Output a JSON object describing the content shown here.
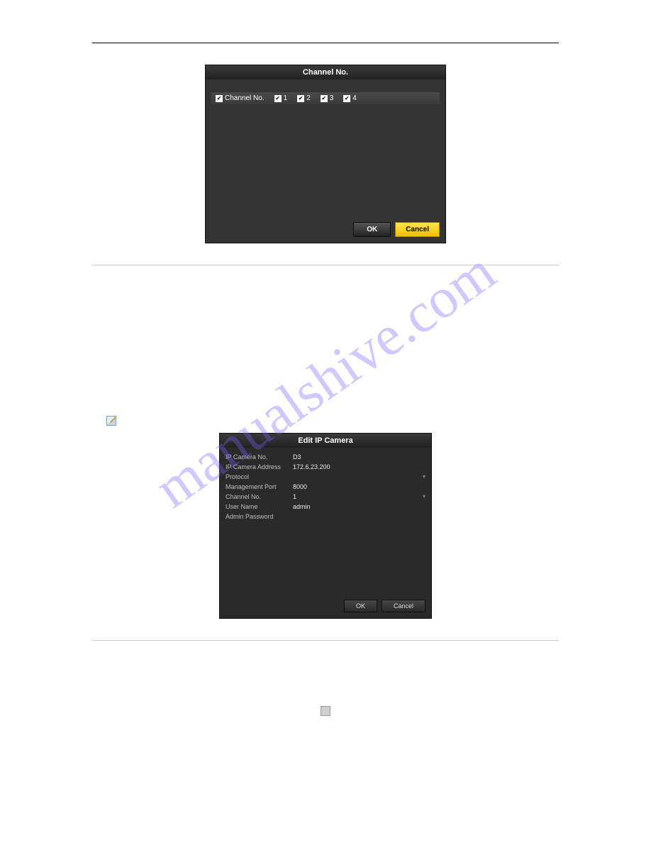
{
  "dialog1": {
    "title": "Channel No.",
    "header_label": "Channel No.",
    "options": [
      "1",
      "2",
      "3",
      "4"
    ],
    "ok": "OK",
    "cancel": "Cancel"
  },
  "dialog2": {
    "title": "Edit IP Camera",
    "fields": {
      "camno_label": "IP Camera No.",
      "camno_val": "D3",
      "addr_label": "IP Camera Address",
      "addr_val": "172.6.23.200",
      "proto_label": "Protocol",
      "proto_val": "",
      "port_label": "Management Port",
      "port_val": "8000",
      "chno_label": "Channel No.",
      "chno_val": "1",
      "user_label": "User Name",
      "user_val": "admin",
      "pwd_label": "Admin Password",
      "pwd_val": ""
    },
    "ok": "OK",
    "cancel": "Cancel"
  },
  "watermark": "manualshive.com"
}
